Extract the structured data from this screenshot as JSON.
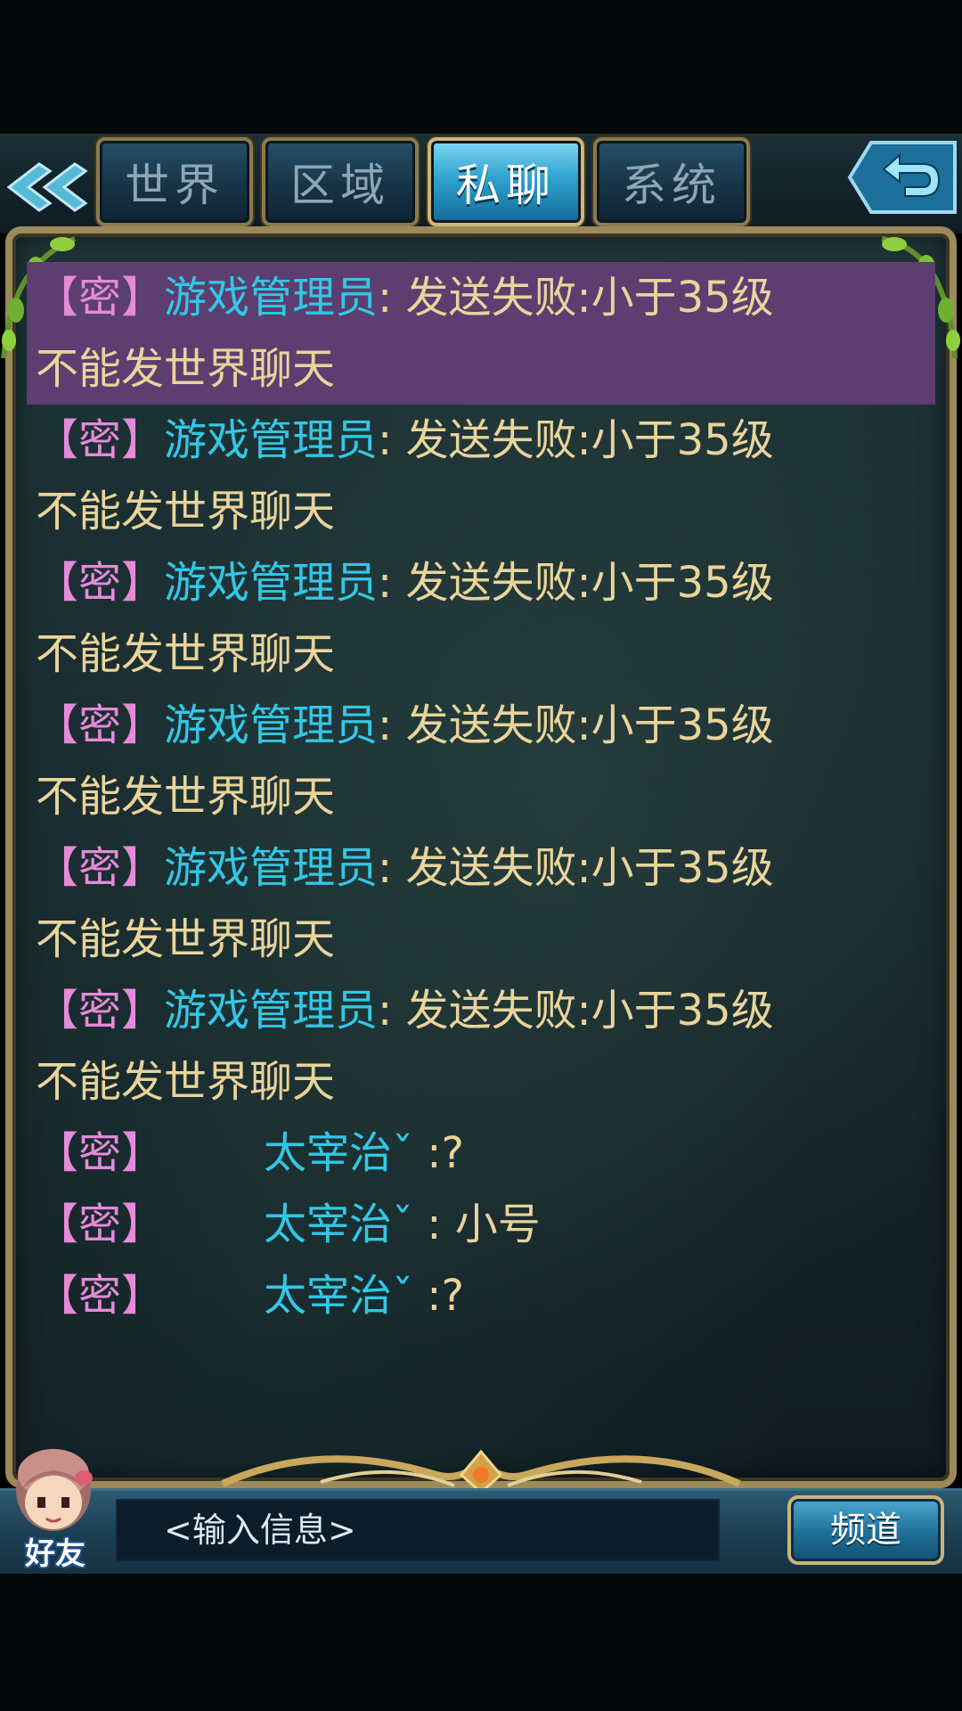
{
  "tabs": [
    {
      "label": "世界",
      "active": false
    },
    {
      "label": "区域",
      "active": false
    },
    {
      "label": "私聊",
      "active": true
    },
    {
      "label": "系统",
      "active": false
    }
  ],
  "icons": {
    "back": "double-chevron-left-icon",
    "exit": "return-arrow-icon",
    "friend": "girl-avatar-icon"
  },
  "messages": [
    {
      "tag": "【密】",
      "sender": "游戏管理员",
      "colon": ":",
      "content": " 发送失败:小于35级",
      "content2": "不能发世界聊天",
      "highlight": true
    },
    {
      "tag": "【密】",
      "sender": "游戏管理员",
      "colon": ":",
      "content": " 发送失败:小于35级",
      "content2": "不能发世界聊天",
      "highlight": false
    },
    {
      "tag": "【密】",
      "sender": "游戏管理员",
      "colon": ":",
      "content": " 发送失败:小于35级",
      "content2": "不能发世界聊天",
      "highlight": false
    },
    {
      "tag": "【密】",
      "sender": "游戏管理员",
      "colon": ":",
      "content": " 发送失败:小于35级",
      "content2": "不能发世界聊天",
      "highlight": false
    },
    {
      "tag": "【密】",
      "sender": "游戏管理员",
      "colon": ":",
      "content": " 发送失败:小于35级",
      "content2": "不能发世界聊天",
      "highlight": false
    },
    {
      "tag": "【密】",
      "sender": "游戏管理员",
      "colon": ":",
      "content": " 发送失败:小于35级",
      "content2": "不能发世界聊天",
      "highlight": false
    },
    {
      "tag": "【密】",
      "sender": "太宰治ˇ",
      "colon": " :",
      "content": "?"
    },
    {
      "tag": "【密】",
      "sender": "太宰治ˇ",
      "colon": " :",
      "content": " 小号"
    },
    {
      "tag": "【密】",
      "sender": "太宰治ˇ",
      "colon": " :",
      "content": "?"
    }
  ],
  "input": {
    "placeholder": "<输入信息>"
  },
  "friend_label": "好友",
  "channel_label": "频道",
  "colors": {
    "tag": "#e58ad9",
    "sender": "#33c7e6",
    "content": "#e9d49b",
    "highlight": "#5d3e70",
    "frame": "#9c8a5a"
  }
}
